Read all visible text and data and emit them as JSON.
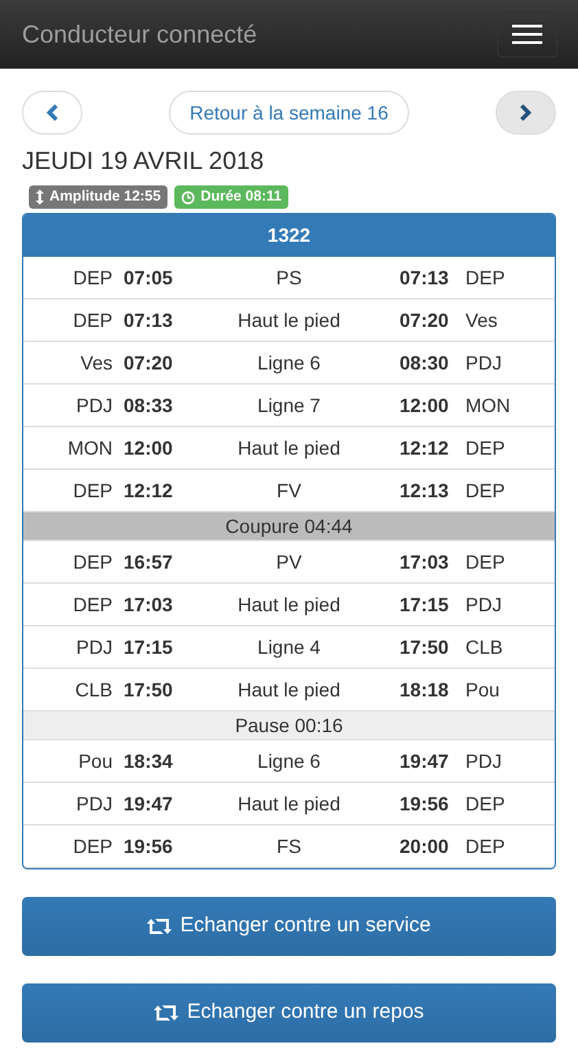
{
  "navbar": {
    "title": "Conducteur connecté"
  },
  "nav": {
    "prev": {
      "active": false
    },
    "back": "Retour à la semaine 16",
    "next": {
      "active": true
    }
  },
  "date": "JEUDI 19 AVRIL 2018",
  "badges": [
    {
      "kind": "amplitude",
      "label": "Amplitude 12:55"
    },
    {
      "kind": "duration",
      "label": "Durée 08:11"
    }
  ],
  "service": {
    "title": "1322",
    "rows": [
      {
        "kind": "trip",
        "from": "DEP",
        "start": "07:05",
        "label": "PS",
        "end": "07:13",
        "to": "DEP"
      },
      {
        "kind": "trip",
        "from": "DEP",
        "start": "07:13",
        "label": "Haut le pied",
        "end": "07:20",
        "to": "Ves"
      },
      {
        "kind": "trip",
        "from": "Ves",
        "start": "07:20",
        "label": "Ligne 6",
        "end": "08:30",
        "to": "PDJ"
      },
      {
        "kind": "trip",
        "from": "PDJ",
        "start": "08:33",
        "label": "Ligne 7",
        "end": "12:00",
        "to": "MON"
      },
      {
        "kind": "trip",
        "from": "MON",
        "start": "12:00",
        "label": "Haut le pied",
        "end": "12:12",
        "to": "DEP"
      },
      {
        "kind": "trip",
        "from": "DEP",
        "start": "12:12",
        "label": "FV",
        "end": "12:13",
        "to": "DEP"
      },
      {
        "kind": "cut",
        "label": "Coupure 04:44"
      },
      {
        "kind": "trip",
        "from": "DEP",
        "start": "16:57",
        "label": "PV",
        "end": "17:03",
        "to": "DEP"
      },
      {
        "kind": "trip",
        "from": "DEP",
        "start": "17:03",
        "label": "Haut le pied",
        "end": "17:15",
        "to": "PDJ"
      },
      {
        "kind": "trip",
        "from": "PDJ",
        "start": "17:15",
        "label": "Ligne 4",
        "end": "17:50",
        "to": "CLB"
      },
      {
        "kind": "trip",
        "from": "CLB",
        "start": "17:50",
        "label": "Haut le pied",
        "end": "18:18",
        "to": "Pou"
      },
      {
        "kind": "pause",
        "label": "Pause 00:16"
      },
      {
        "kind": "trip",
        "from": "Pou",
        "start": "18:34",
        "label": "Ligne 6",
        "end": "19:47",
        "to": "PDJ"
      },
      {
        "kind": "trip",
        "from": "PDJ",
        "start": "19:47",
        "label": "Haut le pied",
        "end": "19:56",
        "to": "DEP"
      },
      {
        "kind": "trip",
        "from": "DEP",
        "start": "19:56",
        "label": "FS",
        "end": "20:00",
        "to": "DEP"
      }
    ]
  },
  "actions": [
    "Echanger contre un service",
    "Echanger contre un repos"
  ]
}
